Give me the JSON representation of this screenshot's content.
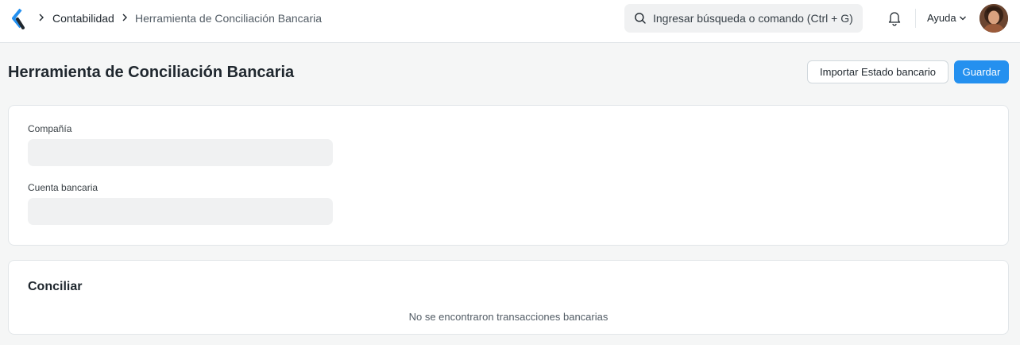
{
  "navbar": {
    "breadcrumbs": [
      {
        "label": "Contabilidad"
      },
      {
        "label": "Herramienta de Conciliación Bancaria"
      }
    ],
    "search": {
      "placeholder": "Ingresar búsqueda o comando (Ctrl + G)"
    },
    "help_label": "Ayuda"
  },
  "page": {
    "title": "Herramienta de Conciliación Bancaria",
    "buttons": {
      "import_label": "Importar Estado bancario",
      "save_label": "Guardar"
    }
  },
  "form": {
    "company_label": "Compañía",
    "company_value": "",
    "bank_account_label": "Cuenta bancaria",
    "bank_account_value": ""
  },
  "reconcile": {
    "title": "Conciliar",
    "empty_message": "No se encontraron transacciones bancarias"
  },
  "colors": {
    "primary": "#2490ef",
    "background": "#f5f6f6",
    "text": "#1f272e"
  },
  "icons": [
    "app-logo-icon",
    "chevron-right-icon",
    "search-icon",
    "bell-icon",
    "chevron-down-icon"
  ]
}
